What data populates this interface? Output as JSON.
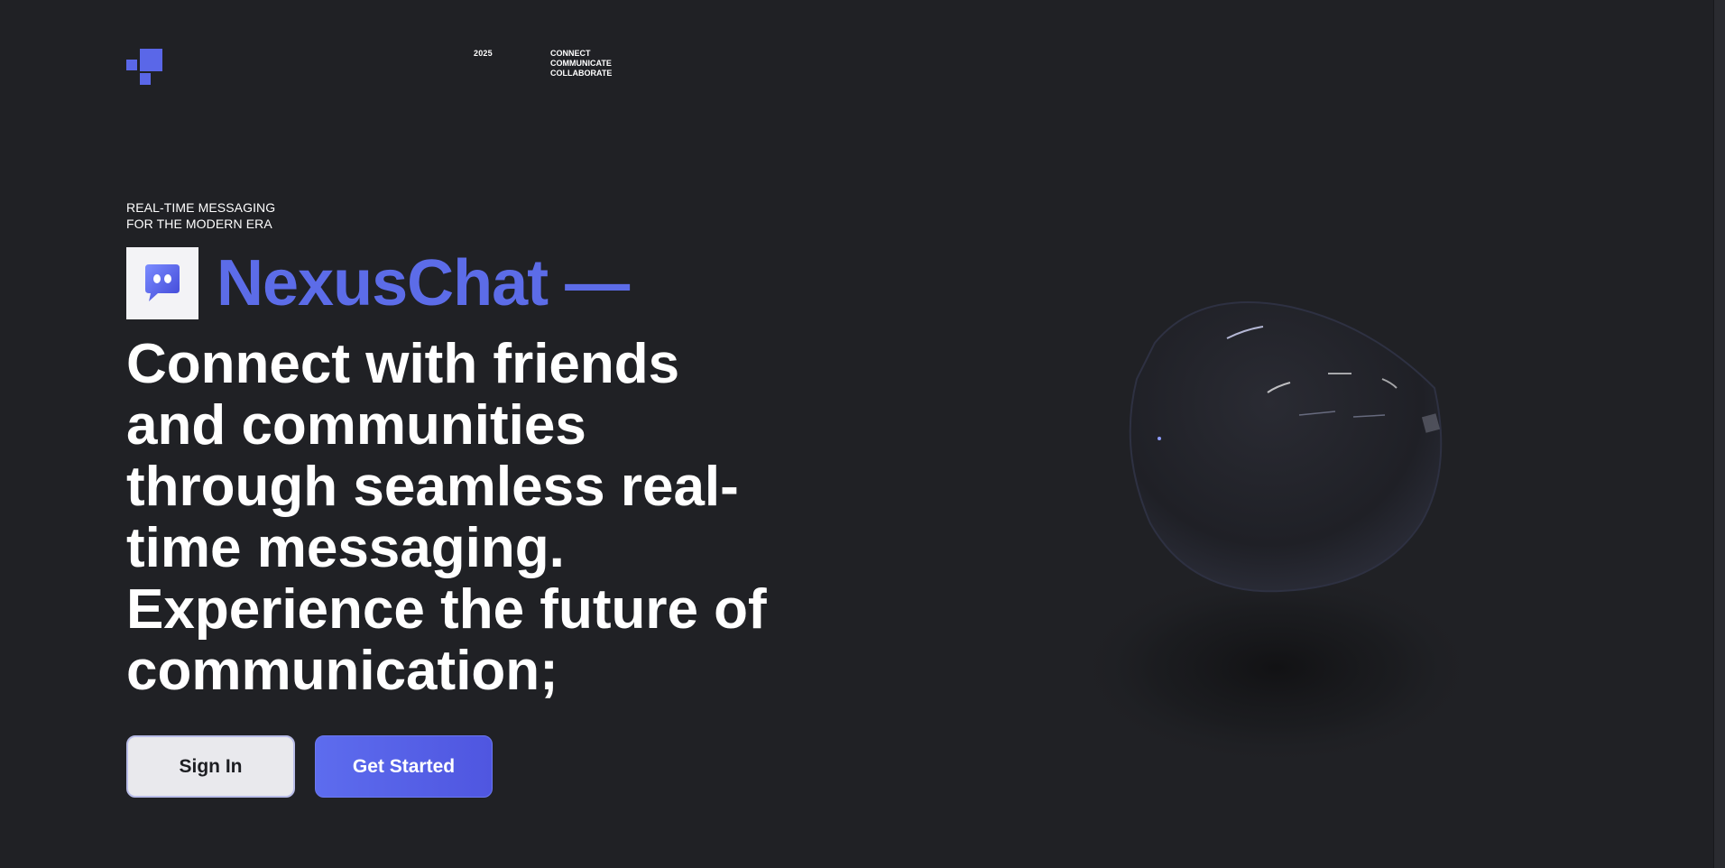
{
  "header": {
    "logo_icon": "pixel-blocks-logo",
    "year": "2025",
    "tagline": [
      "CONNECT",
      "COMMUNICATE",
      "COLLABORATE"
    ]
  },
  "hero": {
    "eyebrow": [
      "REAL-TIME MESSAGING",
      "FOR THE MODERN ERA"
    ],
    "app_icon": "chat-bubble-icon",
    "brand": "NexusChat —",
    "headline": "Connect with friends and communities through seamless real-time messaging. Experience the future of communication;",
    "buttons": {
      "signin": "Sign In",
      "get_started": "Get Started"
    }
  },
  "colors": {
    "background": "#202125",
    "accent": "#5c6ce8",
    "text": "#ffffff"
  }
}
